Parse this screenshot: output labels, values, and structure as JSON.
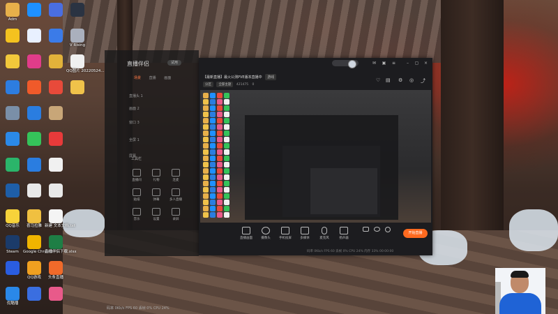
{
  "desktop_icons": [
    {
      "label": "Adm",
      "color": "#e8b04a",
      "col": 0,
      "row": 0
    },
    {
      "label": "",
      "color": "#1e90ff",
      "col": 1,
      "row": 0
    },
    {
      "label": "",
      "color": "#4a6ee0",
      "col": 2,
      "row": 0
    },
    {
      "label": "",
      "color": "#2a3342",
      "col": 3,
      "row": 0
    },
    {
      "label": "",
      "color": "#f4c21f",
      "col": 0,
      "row": 1
    },
    {
      "label": "",
      "color": "#e8f0ff",
      "col": 1,
      "row": 1
    },
    {
      "label": "",
      "color": "#3b7be8",
      "col": 2,
      "row": 1
    },
    {
      "label": "V Rising",
      "color": "#aab0bd",
      "col": 3,
      "row": 1
    },
    {
      "label": "",
      "color": "#f2c83b",
      "col": 0,
      "row": 2
    },
    {
      "label": "",
      "color": "#e03c8a",
      "col": 1,
      "row": 2
    },
    {
      "label": "",
      "color": "#e2b23a",
      "col": 2,
      "row": 2
    },
    {
      "label": "QQ图片 20220524...",
      "color": "#f0f0f0",
      "col": 3,
      "row": 2
    },
    {
      "label": "",
      "color": "#2d7de0",
      "col": 0,
      "row": 3
    },
    {
      "label": "",
      "color": "#f05a2a",
      "col": 1,
      "row": 3
    },
    {
      "label": "",
      "color": "#e84a3a",
      "col": 2,
      "row": 3
    },
    {
      "label": "",
      "color": "#f0c24a",
      "col": 3,
      "row": 3
    },
    {
      "label": "",
      "color": "#7a8fa8",
      "col": 0,
      "row": 4
    },
    {
      "label": "",
      "color": "#2a7de0",
      "col": 1,
      "row": 4
    },
    {
      "label": "",
      "color": "#c8a678",
      "col": 2,
      "row": 4
    },
    {
      "label": "",
      "color": "#2b89e8",
      "col": 0,
      "row": 5
    },
    {
      "label": "",
      "color": "#35c35a",
      "col": 1,
      "row": 5
    },
    {
      "label": "",
      "color": "#e83a3a",
      "col": 2,
      "row": 5
    },
    {
      "label": "",
      "color": "#2bb56a",
      "col": 0,
      "row": 6
    },
    {
      "label": "",
      "color": "#2a7de0",
      "col": 1,
      "row": 6
    },
    {
      "label": "",
      "color": "#f0f0f0",
      "col": 2,
      "row": 6
    },
    {
      "label": "",
      "color": "#1e5ea8",
      "col": 0,
      "row": 7
    },
    {
      "label": "",
      "color": "#e8e8e8",
      "col": 1,
      "row": 7
    },
    {
      "label": "",
      "color": "#e8e8e8",
      "col": 2,
      "row": 7
    },
    {
      "label": "QQ音乐",
      "color": "#f7d23a",
      "col": 0,
      "row": 8
    },
    {
      "label": "喜马拉雅",
      "color": "#f0c040",
      "col": 1,
      "row": 8
    },
    {
      "label": "新建 文本文档.txt",
      "color": "#f4f4f4",
      "col": 2,
      "row": 8
    },
    {
      "label": "Steam",
      "color": "#1b3b6a",
      "col": 0,
      "row": 9
    },
    {
      "label": "Google Chrome",
      "color": "#f0b400",
      "col": 1,
      "row": 9
    },
    {
      "label": "直播伴侣下载.xlsx",
      "color": "#1e7e45",
      "col": 2,
      "row": 9
    },
    {
      "label": "",
      "color": "#2a5de0",
      "col": 0,
      "row": 10
    },
    {
      "label": "QQ游戏",
      "color": "#f0a020",
      "col": 1,
      "row": 10
    },
    {
      "label": "头条直播",
      "color": "#f06a2a",
      "col": 2,
      "row": 10
    },
    {
      "label": "优酷播",
      "color": "#2a88e8",
      "col": 0,
      "row": 11
    },
    {
      "label": "",
      "color": "#3a6ee0",
      "col": 1,
      "row": 11
    },
    {
      "label": "",
      "color": "#e85a8a",
      "col": 2,
      "row": 11
    }
  ],
  "bg_app": {
    "logo": "直播伴侣",
    "badge": "试用",
    "tabs": [
      "场景",
      "直播",
      "画面"
    ],
    "scenes": [
      "直播头 1",
      "画面 2",
      "窗口 3",
      "全屏 1",
      "屏幕"
    ],
    "tools_title": "工具栏",
    "tools": [
      "直播间",
      "礼物",
      "连麦",
      "贴纸",
      "弹幕",
      "多人直播",
      "音乐",
      "设置",
      "录屏"
    ],
    "status": "码率 0Kb/s  FPS 60  丢帧 0%  CPU 24%"
  },
  "main_window": {
    "stream_title": "【最新直播】最火公测PVE版本直播中",
    "tag_1": "游戏",
    "sub_tags": [
      "分区",
      "全部主题"
    ],
    "viewer_count": "421475",
    "likes": "0",
    "controls": [
      {
        "label": "直播画面",
        "name": "screen"
      },
      {
        "label": "摄像头",
        "name": "camera"
      },
      {
        "label": "手机投屏",
        "name": "phone"
      },
      {
        "label": "多媒体",
        "name": "media"
      },
      {
        "label": "麦克风",
        "name": "mic"
      },
      {
        "label": "扬声器",
        "name": "speaker"
      }
    ],
    "start_label": "开始直播",
    "status": "码率 0Kb/s   FPS 60   丢帧 0%   CPU 24%   内存 33%   00:00:00"
  },
  "colors": {
    "accent": "#ff6a1f",
    "panel": "#1c1c1f"
  }
}
